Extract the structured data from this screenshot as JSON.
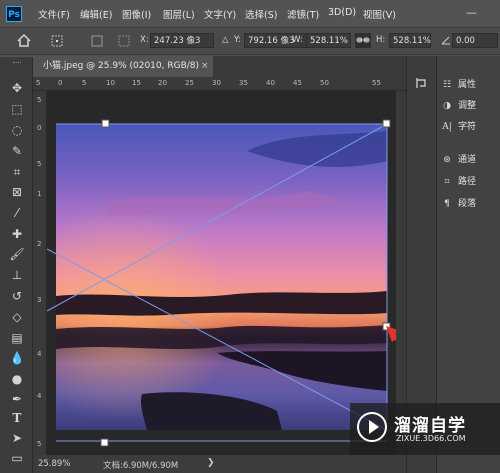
{
  "app": {
    "logo": "Ps"
  },
  "menu": [
    "文件(F)",
    "编辑(E)",
    "图像(I)",
    "图层(L)",
    "文字(Y)",
    "选择(S)",
    "滤镜(T)",
    "3D(D)",
    "视图(V)"
  ],
  "window_controls": {
    "minimize": "—"
  },
  "options_bar": {
    "x_label": "X:",
    "x_value": "247.23 像3",
    "y_label": "Y:",
    "y_value": "792.16 像3",
    "w_label": "W:",
    "w_value": "528.11%",
    "h_label": "H:",
    "h_value": "528.11%",
    "angle_value": "0.00"
  },
  "document": {
    "tab_title": "小猫.jpeg @ 25.9% (02010, RGB/8)",
    "tab_close": "×",
    "zoom": "25.89%",
    "doc_info": "文档:6.90M/6.90M",
    "ruler_top": [
      "5",
      "0",
      "5",
      "10",
      "15",
      "20",
      "25",
      "30",
      "35",
      "40",
      "45",
      "50",
      "55"
    ],
    "ruler_left": [
      "5",
      "0",
      "5",
      "1",
      "2",
      "3",
      "4",
      "4",
      "5"
    ]
  },
  "right_panel": {
    "items": [
      {
        "icon": "properties-icon",
        "label": "属性"
      },
      {
        "icon": "adjustments-icon",
        "label": "调整"
      },
      {
        "icon": "character-icon",
        "label": "字符"
      },
      {
        "icon": "channels-icon",
        "label": "通道"
      },
      {
        "icon": "paths-icon",
        "label": "路径"
      },
      {
        "icon": "paragraph-icon",
        "label": "段落"
      }
    ]
  },
  "watermark": {
    "title": "溜溜自学",
    "url": "ZIXUE.3D66.COM"
  },
  "colors": {
    "arrow": "#e0342a",
    "transform_line": "#7f9ce8",
    "handle": "#ffffff"
  }
}
